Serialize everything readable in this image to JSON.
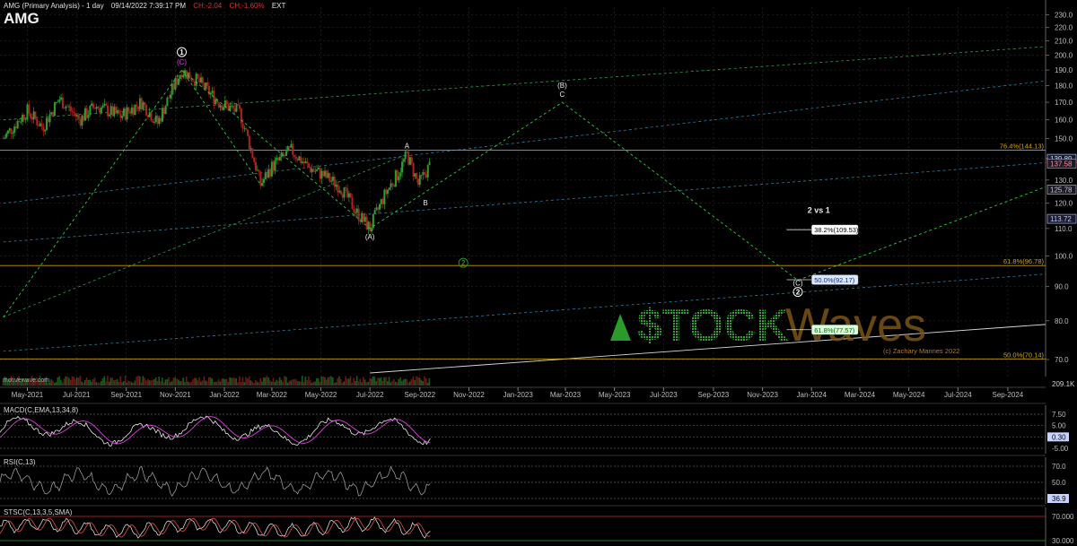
{
  "header": {
    "title": "AMG (Primary Analysis) - 1 day",
    "datetime": "09/14/2022 7:39:17 PM",
    "change": "CH:-2.04",
    "change_pct": "CH:-1.60%",
    "session": "EXT",
    "symbol": "AMG"
  },
  "site": "motivewave.com",
  "watermark": {
    "text": "$TOCK",
    "text2": "Waves",
    "copyright": "(c) Zachary Mannes 2022"
  },
  "colors": {
    "background": "#000000",
    "up_candle": "#2e9e2e",
    "down_candle": "#b02020",
    "wave": "#2ecc40",
    "fib": "#c8a000",
    "channel": "#2a7fa0",
    "pink": "#e040e0"
  },
  "chart_data": [
    {
      "type": "candlestick",
      "title": "AMG (Primary Analysis) - 1 day",
      "x_ticks": [
        "May-2021",
        "Jul-2021",
        "Sep-2021",
        "Nov-2021",
        "Jan-2022",
        "Mar-2022",
        "May-2022",
        "Jul-2022",
        "Sep-2022",
        "Nov-2022",
        "Jan-2023",
        "Mar-2023",
        "May-2023",
        "Jul-2023",
        "Sep-2023",
        "Nov-2023",
        "Jan-2024",
        "Mar-2024",
        "May-2024",
        "Jul-2024",
        "Sep-2024"
      ],
      "y_ticks": [
        230,
        220,
        210,
        200,
        190,
        180,
        170,
        160,
        150,
        140,
        130,
        120,
        110,
        100,
        90,
        80,
        70
      ],
      "y_scale": "log",
      "ylim": [
        66,
        236
      ],
      "close_path": [
        {
          "x": "2021-04-01",
          "y": 150
        },
        {
          "x": "2021-05-01",
          "y": 165
        },
        {
          "x": "2021-05-20",
          "y": 156
        },
        {
          "x": "2021-06-10",
          "y": 172
        },
        {
          "x": "2021-07-05",
          "y": 160
        },
        {
          "x": "2021-07-25",
          "y": 168
        },
        {
          "x": "2021-08-25",
          "y": 162
        },
        {
          "x": "2021-09-20",
          "y": 170
        },
        {
          "x": "2021-10-10",
          "y": 158
        },
        {
          "x": "2021-11-09",
          "y": 190
        },
        {
          "x": "2021-12-01",
          "y": 182
        },
        {
          "x": "2021-12-25",
          "y": 170
        },
        {
          "x": "2022-01-20",
          "y": 164
        },
        {
          "x": "2022-02-15",
          "y": 128
        },
        {
          "x": "2022-03-01",
          "y": 136
        },
        {
          "x": "2022-03-25",
          "y": 144
        },
        {
          "x": "2022-04-15",
          "y": 136
        },
        {
          "x": "2022-05-05",
          "y": 132
        },
        {
          "x": "2022-05-25",
          "y": 127
        },
        {
          "x": "2022-06-15",
          "y": 116
        },
        {
          "x": "2022-07-01",
          "y": 110
        },
        {
          "x": "2022-07-20",
          "y": 124
        },
        {
          "x": "2022-08-05",
          "y": 133
        },
        {
          "x": "2022-08-16",
          "y": 142
        },
        {
          "x": "2022-08-30",
          "y": 128
        },
        {
          "x": "2022-09-14",
          "y": 137
        }
      ],
      "price_labels": [
        "139.89",
        "137.58",
        "125.78",
        "113.72"
      ],
      "fib_levels": [
        {
          "label": "76.4%(144.13)",
          "value": 144.13
        },
        {
          "label": "61.8%(96.78)",
          "value": 96.78
        },
        {
          "label": "50.0%(70.14)",
          "value": 70.14
        }
      ],
      "target_boxes": [
        {
          "label": "38.2%(109.53)",
          "value": 109.53
        },
        {
          "label": "50.0%(92.17)",
          "value": 92.17
        },
        {
          "label": "61.8%(77.57)",
          "value": 77.57
        }
      ],
      "wave_labels": [
        {
          "text": "1",
          "x": "2021-11-09",
          "y": 190
        },
        {
          "text": "(C)",
          "x": "2021-11-09",
          "y": 190
        },
        {
          "text": "A",
          "x": "2022-08-16",
          "y": 142
        },
        {
          "text": "B",
          "x": "2022-09-08",
          "y": 124
        },
        {
          "text": "(A)",
          "x": "2022-07-01",
          "y": 110
        },
        {
          "text": "(B)",
          "x": "2023-02-25",
          "y": 170
        },
        {
          "text": "C",
          "x": "2023-02-25",
          "y": 170
        },
        {
          "text": "(C)",
          "x": "2023-12-15",
          "y": 92
        },
        {
          "text": "2",
          "x": "2023-12-15",
          "y": 92
        },
        {
          "text": "2",
          "x": "2022-10-25",
          "y": 98
        },
        {
          "text": "2 vs 1",
          "x": "2024-01-10",
          "y": 116
        }
      ],
      "volume_label": "209.1K"
    },
    {
      "type": "line",
      "title": "MACD(C,EMA,13,34,8)",
      "y_ticks": [
        "7.50",
        "5.00",
        "0.30",
        "-5.00"
      ]
    },
    {
      "type": "line",
      "title": "RSI(C,13)",
      "y_ticks": [
        "70.0",
        "50.0",
        "36.9"
      ]
    },
    {
      "type": "line",
      "title": "STSC(C,13,3,5,SMA)",
      "y_ticks": [
        "70.000",
        "30.000"
      ]
    }
  ]
}
